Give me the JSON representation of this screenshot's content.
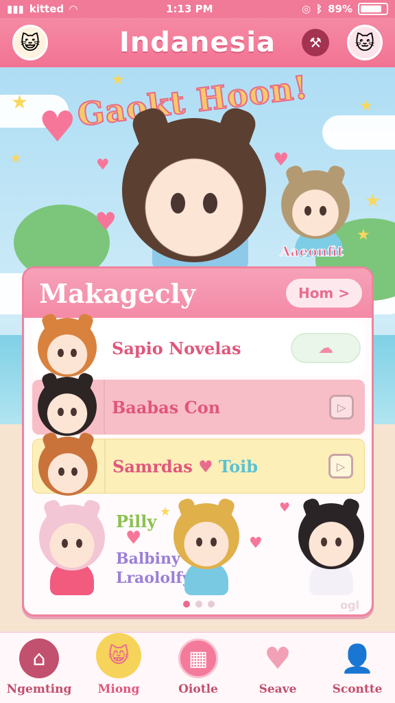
{
  "status_bar": {
    "carrier": "kitted",
    "time": "1:13 PM",
    "battery": "89%"
  },
  "header": {
    "title": "Indanesia",
    "tools_icon": "tools-icon",
    "left_avatar_icon": "avatar-icon",
    "right_avatar_icon": "avatar-icon"
  },
  "banner": {
    "title": "Gaokt Hoon!",
    "character_label": "Aaeonfit"
  },
  "panel": {
    "title": "Makagecly",
    "more_label": "Hom >",
    "rows": [
      {
        "label": "Sapio Novelas",
        "action": "pill"
      },
      {
        "label": "Baabas Con",
        "action": "play"
      },
      {
        "label": "Samrdas",
        "label_suffix": "Toib",
        "action": "play"
      }
    ],
    "gallery": {
      "text_1": "Pilly",
      "text_2": "Balbiny",
      "text_3": "Lraololfy",
      "corner_mark": "ogl"
    }
  },
  "bottom_nav": {
    "items": [
      {
        "label": "Ngemting",
        "icon": "home-icon"
      },
      {
        "label": "Miong",
        "icon": "cat-icon"
      },
      {
        "label": "Oiotle",
        "icon": "calendar-icon"
      },
      {
        "label": "Seave",
        "icon": "heart-icon"
      },
      {
        "label": "Scontte",
        "icon": "user-icon"
      }
    ]
  },
  "colors": {
    "accent": "#f27393",
    "panel_border": "#f0839f",
    "row_pink": "#f8bec7",
    "row_yellow": "#fcefb8"
  }
}
